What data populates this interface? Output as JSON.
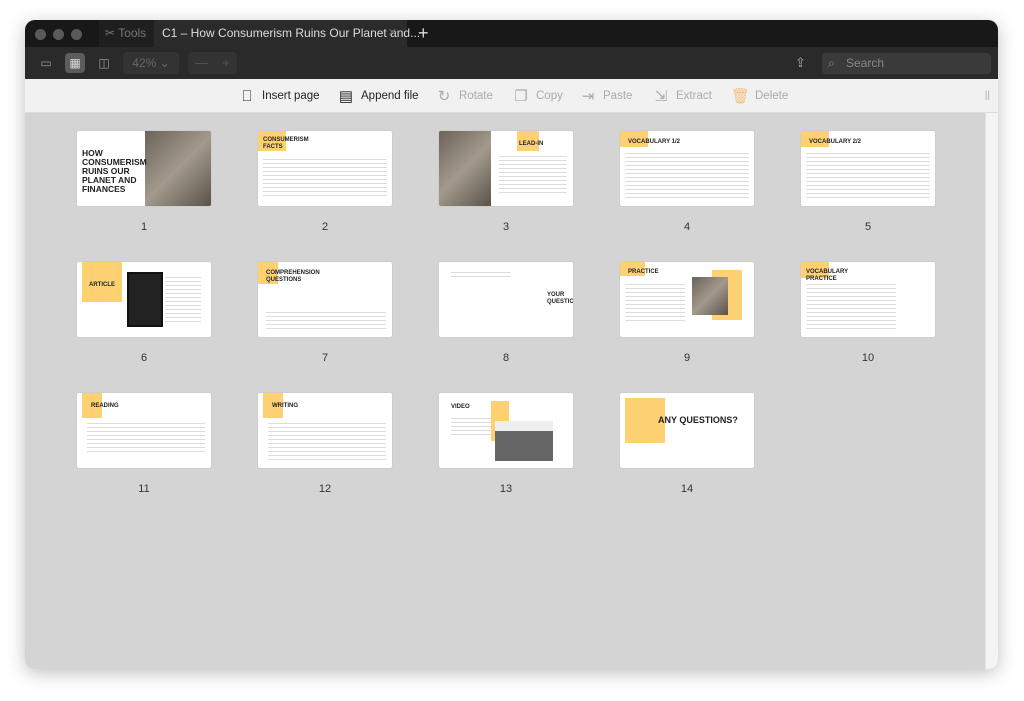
{
  "titlebar": {
    "tabs": [
      {
        "label": "Tools",
        "icon": "tools-icon"
      },
      {
        "label": "C1 – How Consumerism Ruins Our Planet and...",
        "active": true
      }
    ],
    "new_tab": "+"
  },
  "toolbar": {
    "zoom": "42%",
    "zoom_out": "—",
    "zoom_in": "+",
    "search_placeholder": "Search"
  },
  "actions": [
    {
      "label": "Insert page",
      "icon": "insert-page-icon",
      "enabled": true
    },
    {
      "label": "Append file",
      "icon": "pdf-icon",
      "enabled": true
    },
    {
      "label": "Rotate",
      "icon": "rotate-icon",
      "enabled": false
    },
    {
      "label": "Copy",
      "icon": "copy-icon",
      "enabled": false
    },
    {
      "label": "Paste",
      "icon": "paste-icon",
      "enabled": false
    },
    {
      "label": "Extract",
      "icon": "extract-icon",
      "enabled": false
    },
    {
      "label": "Delete",
      "icon": "trash-icon",
      "enabled": false
    }
  ],
  "accent": "#fdd172",
  "pages": [
    {
      "n": "1",
      "title": "How Consumerism Ruins Our Planet and Finances"
    },
    {
      "n": "2",
      "title": "Consumerism Facts"
    },
    {
      "n": "3",
      "title": "Lead-in"
    },
    {
      "n": "4",
      "title": "Vocabulary 1/2"
    },
    {
      "n": "5",
      "title": "Vocabulary 2/2"
    },
    {
      "n": "6",
      "title": "Article"
    },
    {
      "n": "7",
      "title": "Comprehension Questions"
    },
    {
      "n": "8",
      "title": "Your Question"
    },
    {
      "n": "9",
      "title": "Practice"
    },
    {
      "n": "10",
      "title": "Vocabulary Practice"
    },
    {
      "n": "11",
      "title": "Reading"
    },
    {
      "n": "12",
      "title": "Writing"
    },
    {
      "n": "13",
      "title": "Video"
    },
    {
      "n": "14",
      "title": "Any Questions?"
    }
  ]
}
